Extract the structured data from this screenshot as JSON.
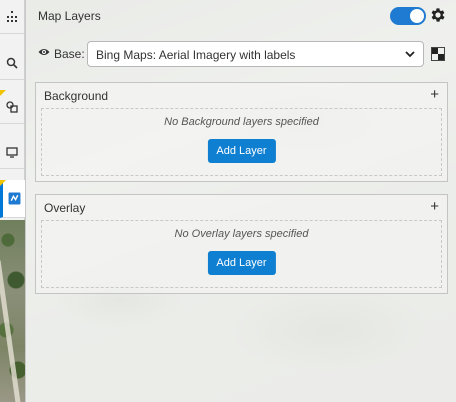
{
  "panel": {
    "title": "Map Layers",
    "visible_toggle": "on"
  },
  "base": {
    "label": "Base:",
    "selected": "Bing Maps: Aerial Imagery with labels"
  },
  "background": {
    "title": "Background",
    "add_icon": "+",
    "empty_text": "No Background layers specified",
    "add_button": "Add Layer"
  },
  "overlay": {
    "title": "Overlay",
    "add_icon": "+",
    "empty_text": "No Overlay layers specified",
    "add_button": "Add Layer"
  },
  "toolbar": {
    "items": [
      {
        "icon": "hierarchy-icon"
      },
      {
        "icon": "search-icon"
      },
      {
        "icon": "shapes-icon"
      },
      {
        "icon": "screen-icon"
      },
      {
        "icon": "map-layers-icon",
        "active": true
      }
    ]
  },
  "colors": {
    "accent": "#0f7fd2",
    "toggle": "#1f7ad1",
    "marker": "#f2c300"
  }
}
